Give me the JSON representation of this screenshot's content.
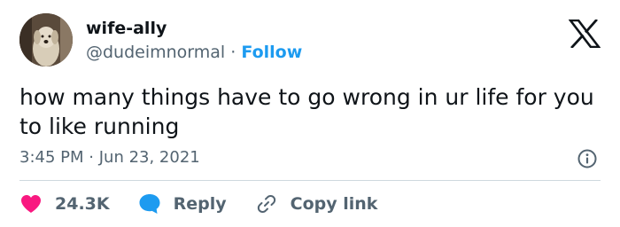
{
  "author": {
    "display_name": "wife-ally",
    "handle": "@dudeimnormal",
    "separator": "·",
    "follow_label": "Follow"
  },
  "tweet": {
    "text": "how many things have to go wrong in ur life for you to like running",
    "time": "3:45 PM",
    "separator": "·",
    "date": "Jun 23, 2021"
  },
  "actions": {
    "like_count": "24.3K",
    "reply_label": "Reply",
    "copy_link_label": "Copy link"
  },
  "colors": {
    "accent": "#1d9bf0",
    "like": "#f91880",
    "text": "#0f1419",
    "muted": "#536471"
  },
  "icons": {
    "brand": "x-logo-icon",
    "info": "info-icon",
    "like": "heart-icon",
    "reply": "speech-bubble-icon",
    "copy": "link-icon"
  }
}
